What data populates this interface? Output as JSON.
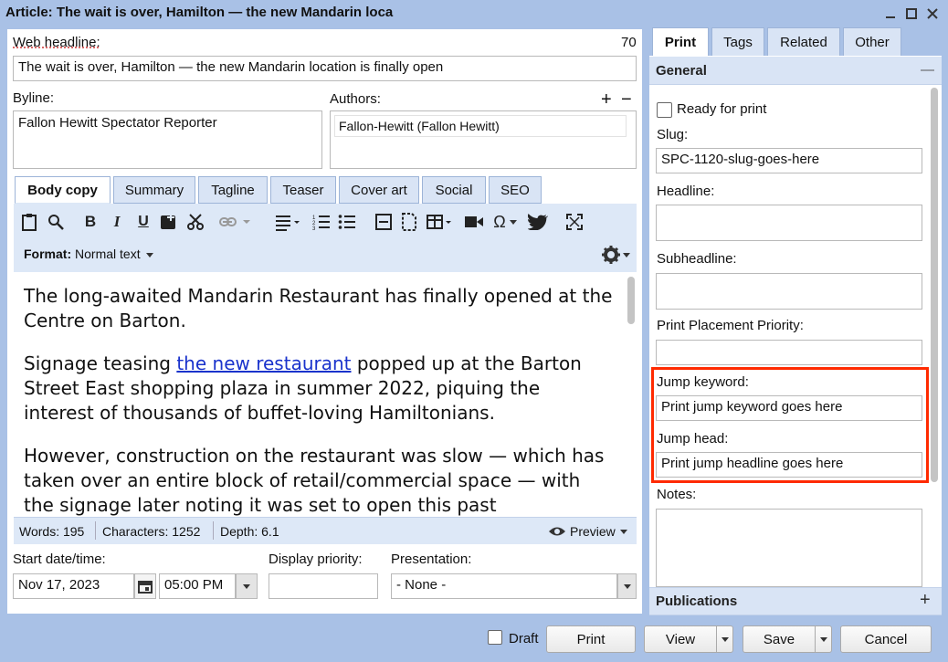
{
  "window": {
    "title": "Article: The wait is over, Hamilton — the new Mandarin loca"
  },
  "form": {
    "web_headline_label": "Web headline:",
    "web_headline_count": "70",
    "web_headline_value": "The wait is over, Hamilton — the new Mandarin location is finally open",
    "byline_label": "Byline:",
    "byline_value": "Fallon Hewitt Spectator Reporter",
    "authors_label": "Authors:",
    "authors_add": "+",
    "authors_remove": "−",
    "author_entry": "Fallon-Hewitt (Fallon Hewitt)"
  },
  "tabs": [
    "Body copy",
    "Summary",
    "Tagline",
    "Teaser",
    "Cover art",
    "Social",
    "SEO"
  ],
  "toolbar": {
    "format_label": "Format:",
    "format_value": "Normal text",
    "icons": [
      "clipboard-icon",
      "find-replace-icon",
      "bold-icon",
      "italic-icon",
      "underline-icon",
      "insert-image-icon",
      "cut-icon",
      "link-icon",
      "align-icon",
      "numbered-list-icon",
      "bullet-list-icon",
      "box-icon",
      "embed-icon",
      "table-icon",
      "video-icon",
      "special-char-icon",
      "twitter-icon",
      "fullscreen-icon"
    ],
    "bold_glyph": "B",
    "italic_glyph": "I",
    "underline_glyph": "U",
    "omega_glyph": "Ω"
  },
  "body": {
    "p1": "The long-awaited Mandarin Restaurant has finally opened at the Centre on Barton.",
    "p2_before": "Signage teasing ",
    "p2_link": "the new restaurant",
    "p2_after": " popped up at the Barton Street East shopping plaza in summer 2022, piquing the interest of thousands of buffet-loving Hamiltonians.",
    "p3": "However, construction on the restaurant was slow — which has taken over an entire block of retail/commercial space — with the signage later noting it was set to open this past"
  },
  "status": {
    "words": "Words: 195",
    "characters": "Characters: 1252",
    "depth": "Depth: 6.1",
    "preview": "Preview"
  },
  "schedule": {
    "start_label": "Start date/time:",
    "date_value": "Nov 17, 2023",
    "time_value": "05:00 PM",
    "priority_label": "Display priority:",
    "priority_value": "",
    "presentation_label": "Presentation:",
    "presentation_value": "- None -"
  },
  "right_tabs": [
    "Print",
    "Tags",
    "Related",
    "Other"
  ],
  "print": {
    "section_title": "General",
    "collapse": "—",
    "ready_label": "Ready for print",
    "slug_label": "Slug:",
    "slug_value": "SPC-1120-slug-goes-here",
    "headline_label": "Headline:",
    "subheadline_label": "Subheadline:",
    "placement_label": "Print Placement Priority:",
    "jump_keyword_label": "Jump keyword:",
    "jump_keyword_value": "Print jump keyword goes here",
    "jump_head_label": "Jump head:",
    "jump_head_value": "Print jump headline goes here",
    "notes_label": "Notes:",
    "publications_label": "Publications",
    "publications_add": "+"
  },
  "footer": {
    "draft_label": "Draft",
    "print_button": "Print",
    "view_button": "View",
    "save_button": "Save",
    "cancel_button": "Cancel"
  },
  "colors": {
    "highlight": "#ff2a00",
    "link": "#1a33cc",
    "chrome": "#a9c1e6"
  }
}
